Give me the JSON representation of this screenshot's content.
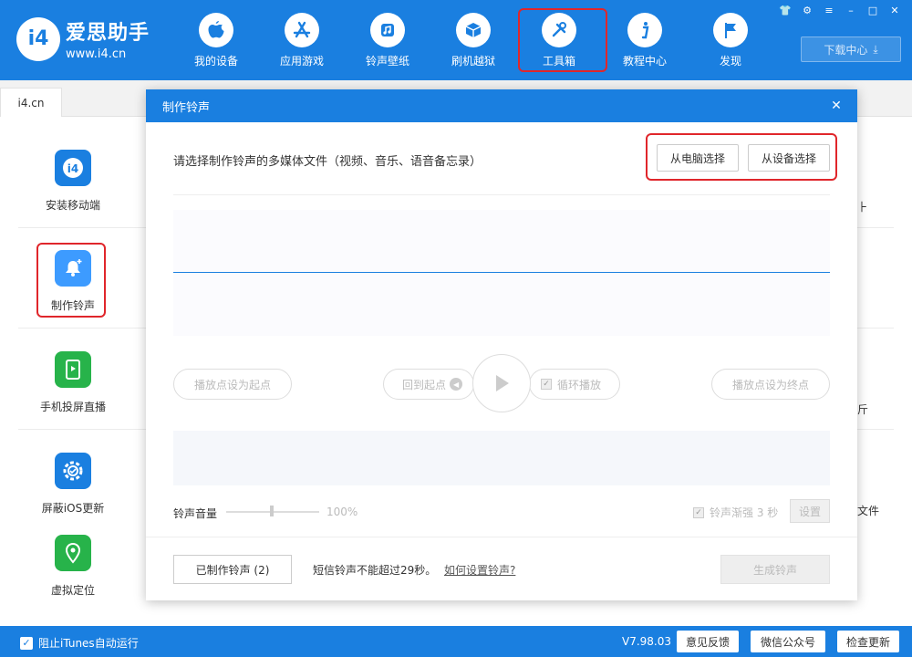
{
  "app": {
    "logo_badge": "i4",
    "logo_name": "爱思助手",
    "logo_url": "www.i4.cn"
  },
  "nav": [
    {
      "label": "我的设备",
      "icon": "apple-icon"
    },
    {
      "label": "应用游戏",
      "icon": "app-store-icon"
    },
    {
      "label": "铃声壁纸",
      "icon": "music-icon"
    },
    {
      "label": "刷机越狱",
      "icon": "box-icon"
    },
    {
      "label": "工具箱",
      "icon": "tools-icon"
    },
    {
      "label": "教程中心",
      "icon": "info-icon"
    },
    {
      "label": "发现",
      "icon": "flag-icon"
    }
  ],
  "header": {
    "download_label": "下载中心"
  },
  "tab": {
    "label": "i4.cn"
  },
  "tools": [
    {
      "label": "安装移动端",
      "icon": "i4-app-icon",
      "color": "#1a7fe0"
    },
    {
      "label": "制作铃声",
      "icon": "bell-icon",
      "color": "#3d9bff"
    },
    {
      "label": "手机投屏直播",
      "icon": "screen-cast-icon",
      "color": "#27b34a"
    },
    {
      "label": "屏蔽iOS更新",
      "icon": "gear-icon",
      "color": "#1a7fe0"
    },
    {
      "label": "虚拟定位",
      "icon": "location-icon",
      "color": "#27b34a"
    }
  ],
  "right_peeks": {
    "p1": "⺊",
    "p2": "斤",
    "p3": "文件"
  },
  "dialog": {
    "title": "制作铃声",
    "prompt": "请选择制作铃声的多媒体文件（视频、音乐、语音备忘录）",
    "from_pc": "从电脑选择",
    "from_device": "从设备选择",
    "set_start": "播放点设为起点",
    "back_start": "回到起点",
    "loop": "循环播放",
    "set_end": "播放点设为终点",
    "volume_label": "铃声音量",
    "volume_value": "100%",
    "volume_percent": 100,
    "fade_label": "铃声渐强 3 秒",
    "setting": "设置",
    "made_count": "已制作铃声 (2)",
    "sms_note": "短信铃声不能超过29秒。",
    "howto": "如何设置铃声?",
    "generate": "生成铃声"
  },
  "statusbar": {
    "block_itunes": "阻止iTunes自动运行",
    "version": "V7.98.03",
    "feedback": "意见反馈",
    "wechat": "微信公众号",
    "update": "检查更新"
  },
  "colors": {
    "brand": "#1a7fe0",
    "highlight": "#e0262b"
  }
}
